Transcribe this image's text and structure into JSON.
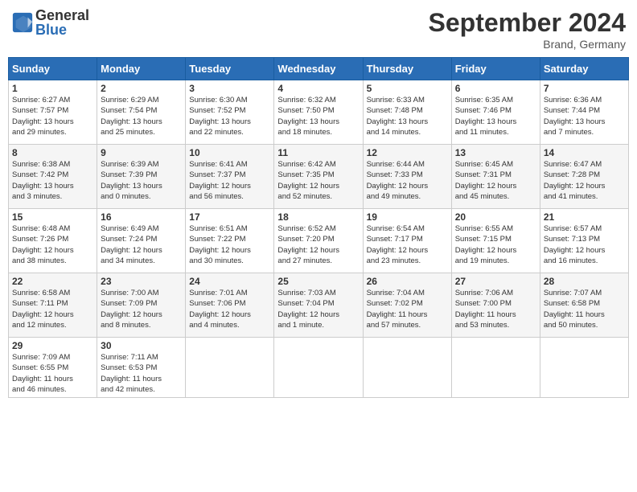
{
  "header": {
    "logo_general": "General",
    "logo_blue": "Blue",
    "month_title": "September 2024",
    "location": "Brand, Germany"
  },
  "days_of_week": [
    "Sunday",
    "Monday",
    "Tuesday",
    "Wednesday",
    "Thursday",
    "Friday",
    "Saturday"
  ],
  "weeks": [
    [
      {
        "day": "1",
        "info": "Sunrise: 6:27 AM\nSunset: 7:57 PM\nDaylight: 13 hours\nand 29 minutes."
      },
      {
        "day": "2",
        "info": "Sunrise: 6:29 AM\nSunset: 7:54 PM\nDaylight: 13 hours\nand 25 minutes."
      },
      {
        "day": "3",
        "info": "Sunrise: 6:30 AM\nSunset: 7:52 PM\nDaylight: 13 hours\nand 22 minutes."
      },
      {
        "day": "4",
        "info": "Sunrise: 6:32 AM\nSunset: 7:50 PM\nDaylight: 13 hours\nand 18 minutes."
      },
      {
        "day": "5",
        "info": "Sunrise: 6:33 AM\nSunset: 7:48 PM\nDaylight: 13 hours\nand 14 minutes."
      },
      {
        "day": "6",
        "info": "Sunrise: 6:35 AM\nSunset: 7:46 PM\nDaylight: 13 hours\nand 11 minutes."
      },
      {
        "day": "7",
        "info": "Sunrise: 6:36 AM\nSunset: 7:44 PM\nDaylight: 13 hours\nand 7 minutes."
      }
    ],
    [
      {
        "day": "8",
        "info": "Sunrise: 6:38 AM\nSunset: 7:42 PM\nDaylight: 13 hours\nand 3 minutes."
      },
      {
        "day": "9",
        "info": "Sunrise: 6:39 AM\nSunset: 7:39 PM\nDaylight: 13 hours\nand 0 minutes."
      },
      {
        "day": "10",
        "info": "Sunrise: 6:41 AM\nSunset: 7:37 PM\nDaylight: 12 hours\nand 56 minutes."
      },
      {
        "day": "11",
        "info": "Sunrise: 6:42 AM\nSunset: 7:35 PM\nDaylight: 12 hours\nand 52 minutes."
      },
      {
        "day": "12",
        "info": "Sunrise: 6:44 AM\nSunset: 7:33 PM\nDaylight: 12 hours\nand 49 minutes."
      },
      {
        "day": "13",
        "info": "Sunrise: 6:45 AM\nSunset: 7:31 PM\nDaylight: 12 hours\nand 45 minutes."
      },
      {
        "day": "14",
        "info": "Sunrise: 6:47 AM\nSunset: 7:28 PM\nDaylight: 12 hours\nand 41 minutes."
      }
    ],
    [
      {
        "day": "15",
        "info": "Sunrise: 6:48 AM\nSunset: 7:26 PM\nDaylight: 12 hours\nand 38 minutes."
      },
      {
        "day": "16",
        "info": "Sunrise: 6:49 AM\nSunset: 7:24 PM\nDaylight: 12 hours\nand 34 minutes."
      },
      {
        "day": "17",
        "info": "Sunrise: 6:51 AM\nSunset: 7:22 PM\nDaylight: 12 hours\nand 30 minutes."
      },
      {
        "day": "18",
        "info": "Sunrise: 6:52 AM\nSunset: 7:20 PM\nDaylight: 12 hours\nand 27 minutes."
      },
      {
        "day": "19",
        "info": "Sunrise: 6:54 AM\nSunset: 7:17 PM\nDaylight: 12 hours\nand 23 minutes."
      },
      {
        "day": "20",
        "info": "Sunrise: 6:55 AM\nSunset: 7:15 PM\nDaylight: 12 hours\nand 19 minutes."
      },
      {
        "day": "21",
        "info": "Sunrise: 6:57 AM\nSunset: 7:13 PM\nDaylight: 12 hours\nand 16 minutes."
      }
    ],
    [
      {
        "day": "22",
        "info": "Sunrise: 6:58 AM\nSunset: 7:11 PM\nDaylight: 12 hours\nand 12 minutes."
      },
      {
        "day": "23",
        "info": "Sunrise: 7:00 AM\nSunset: 7:09 PM\nDaylight: 12 hours\nand 8 minutes."
      },
      {
        "day": "24",
        "info": "Sunrise: 7:01 AM\nSunset: 7:06 PM\nDaylight: 12 hours\nand 4 minutes."
      },
      {
        "day": "25",
        "info": "Sunrise: 7:03 AM\nSunset: 7:04 PM\nDaylight: 12 hours\nand 1 minute."
      },
      {
        "day": "26",
        "info": "Sunrise: 7:04 AM\nSunset: 7:02 PM\nDaylight: 11 hours\nand 57 minutes."
      },
      {
        "day": "27",
        "info": "Sunrise: 7:06 AM\nSunset: 7:00 PM\nDaylight: 11 hours\nand 53 minutes."
      },
      {
        "day": "28",
        "info": "Sunrise: 7:07 AM\nSunset: 6:58 PM\nDaylight: 11 hours\nand 50 minutes."
      }
    ],
    [
      {
        "day": "29",
        "info": "Sunrise: 7:09 AM\nSunset: 6:55 PM\nDaylight: 11 hours\nand 46 minutes."
      },
      {
        "day": "30",
        "info": "Sunrise: 7:11 AM\nSunset: 6:53 PM\nDaylight: 11 hours\nand 42 minutes."
      },
      null,
      null,
      null,
      null,
      null
    ]
  ]
}
